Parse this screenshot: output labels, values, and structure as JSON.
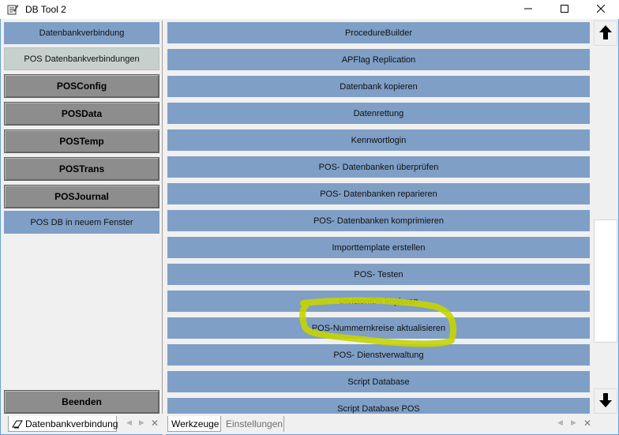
{
  "window": {
    "title": "DB Tool 2",
    "icon": "notepad-pencil-icon",
    "controls": [
      "minimize-icon",
      "maximize-icon",
      "close-icon"
    ]
  },
  "left_panel": {
    "items": [
      {
        "label": "Datenbankverbindung",
        "style": "blue"
      },
      {
        "label": "POS Datenbankverbindungen",
        "style": "selected"
      },
      {
        "label": "POSConfig",
        "style": "gray"
      },
      {
        "label": "POSData",
        "style": "gray"
      },
      {
        "label": "POSTemp",
        "style": "gray"
      },
      {
        "label": "POSTrans",
        "style": "gray"
      },
      {
        "label": "POSJournal",
        "style": "gray"
      },
      {
        "label": "POS DB in neuem Fenster",
        "style": "blue"
      }
    ],
    "exit_label": "Beenden"
  },
  "right_panel": {
    "items": [
      "ProcedureBuilder",
      "APFlag Replication",
      "Datenbank kopieren",
      "Datenrettung",
      "Kennwortlogin",
      "POS- Datenbanken überprüfen",
      "POS- Datenbanken reparieren",
      "POS- Datenbanken komprimieren",
      "Importtemplate erstellen",
      "POS- Testen",
      "DivisionIDs kopieren",
      "POS-Nummernkreise aktualisieren",
      "POS- Dienstverwaltung",
      "Script Database",
      "Script Database POS"
    ],
    "highlighted_item": "POS-Nummernkreise aktualisieren",
    "highlight_color": "#c8d400"
  },
  "bottom_tabs_left": {
    "tabs": [
      {
        "label": "Datenbankverbindung",
        "active": true,
        "icon": "connection-icon"
      }
    ]
  },
  "bottom_tabs_right": {
    "tabs": [
      {
        "label": "Werkzeuge",
        "active": true
      },
      {
        "label": "Einstellungen",
        "active": false
      }
    ]
  },
  "colors": {
    "button_blue": "#7f9fc6",
    "button_gray": "#8d8d8d",
    "selected": "#c6d0cd",
    "frame_border": "#6aa0d8"
  }
}
